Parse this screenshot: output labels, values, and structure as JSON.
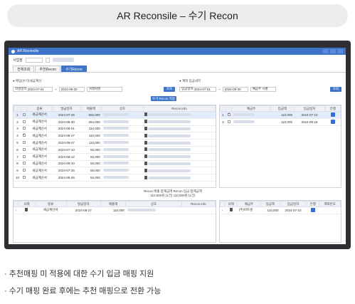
{
  "heading": "AR Reconsile – 수기 Recon",
  "app": {
    "title": "AR Reconcile",
    "tenant_label": "사업장",
    "tabs": [
      {
        "label": "전체조회"
      },
      {
        "label": "추천Recon"
      },
      {
        "label": "수기Recon",
        "active": true
      }
    ],
    "left_section": "매입(수기)세금계산",
    "right_section": "계좌 입금내역",
    "left_filter": {
      "label": "작성일자",
      "from": "2024-07-01",
      "to": "2024-09-30",
      "party_placeholder": "거래처명",
      "search": "조회"
    },
    "right_filter": {
      "label": "입금일자",
      "from": "2024-07-01",
      "to": "2024-09-30",
      "party_label": "예금주",
      "party_value": "시퀀",
      "search": "조회"
    },
    "apply_button": "수기 Recon 적용"
  },
  "left_grid": {
    "columns": [
      "",
      "",
      "종류",
      "발급일자",
      "매출액",
      "상호",
      "Recon info"
    ],
    "rows": [
      {
        "no": "1",
        "checked": false,
        "type": "세금계산서",
        "date": "2024-07-26",
        "amount": "660,000",
        "selected": true
      },
      {
        "no": "2",
        "checked": false,
        "type": "세금계산서",
        "date": "2024-08-30",
        "amount": "264,000"
      },
      {
        "no": "3",
        "checked": false,
        "type": "세금계산서",
        "date": "2024-08-01",
        "amount": "110,000"
      },
      {
        "no": "4",
        "checked": true,
        "type": "세금계산서",
        "date": "2024-08-27",
        "amount": "110,000"
      },
      {
        "no": "5",
        "checked": false,
        "type": "세금계산서",
        "date": "2024-09-27",
        "amount": "110,000"
      },
      {
        "no": "6",
        "checked": false,
        "type": "세금계산서",
        "date": "2024-07-10",
        "amount": "55,000"
      },
      {
        "no": "7",
        "checked": false,
        "type": "세금계산서",
        "date": "2024-08-12",
        "amount": "55,000"
      },
      {
        "no": "8",
        "checked": false,
        "type": "세금계산서",
        "date": "2024-09-10",
        "amount": "55,000"
      },
      {
        "no": "9",
        "checked": false,
        "type": "세금계산서",
        "date": "2024-07-26",
        "amount": "55,000"
      },
      {
        "no": "10",
        "checked": false,
        "type": "세금계산서",
        "date": "2024-08-26",
        "amount": "55,000"
      }
    ]
  },
  "right_grid": {
    "columns": [
      "",
      "",
      "예금주",
      "입금액",
      "입금일자",
      "은행"
    ],
    "rows": [
      {
        "no": "1",
        "checked": true,
        "amount": "110,000",
        "date": "2024-07-10",
        "selected": true
      },
      {
        "no": "2",
        "checked": false,
        "amount": "110,000",
        "date": "2024-08-16"
      }
    ]
  },
  "summary": {
    "label": "Recon 매출 합계금액  Recon 입금 합계금액",
    "values": "110,000원 (1건)  110,000원 (1건)"
  },
  "bottom_left_grid": {
    "columns": [
      "삭제",
      "종류",
      "발급일자",
      "매출액",
      "상호",
      "Recon info"
    ],
    "row": {
      "type": "세금계산서",
      "date": "2024-08-27",
      "amount": "110,000"
    }
  },
  "bottom_right_grid": {
    "columns": [
      "삭제",
      "예금주",
      "입금액",
      "입금일자",
      "은행",
      "계좌번호"
    ],
    "row": {
      "party": "(주)비트센",
      "amount": "110,000",
      "date": "2024-07-10"
    }
  },
  "bullets": [
    "· 추천매핑 미 적용에 대한 수기 입금 매핑 지원",
    "· 수기 매핑 완료 후에는 추천 매핑으로 전환 가능"
  ]
}
